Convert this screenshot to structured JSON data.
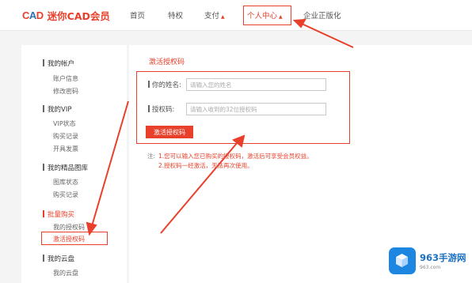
{
  "brand": {
    "logo_mark": "CAD",
    "name": "迷你CAD会员"
  },
  "nav": {
    "home": "首页",
    "privilege": "特权",
    "pay": "支付",
    "personal_center": "个人中心",
    "enterprise": "企业正版化"
  },
  "sidebar": {
    "sections": [
      {
        "title": "我的帐户",
        "items": [
          "账户信息",
          "修改密码"
        ]
      },
      {
        "title": "我的VIP",
        "items": [
          "VIP状态",
          "购买记录",
          "开具发票"
        ]
      },
      {
        "title": "我的精品图库",
        "items": [
          "图库状态",
          "购买记录"
        ]
      },
      {
        "title": "批量购买",
        "items": [
          "我的授权码",
          "激活授权码"
        ],
        "active_item": "激活授权码"
      },
      {
        "title": "我的云盘",
        "items": [
          "我的云盘"
        ]
      }
    ]
  },
  "main": {
    "title": "激活授权码",
    "name_label": "你的姓名:",
    "name_placeholder": "请输入您的姓名",
    "code_label": "授权码:",
    "code_placeholder": "请输入收到的32位授权码",
    "submit_label": "激活授权码",
    "note_label": "注:",
    "note_line1": "1.您可以输入您已购买的授权码，激活后可享受会员权益。",
    "note_line2": "2.授权码一经激活，无法再次使用。"
  },
  "watermark": {
    "title": "963手游网",
    "url": "963.com"
  },
  "colors": {
    "accent": "#e8402b",
    "brand_blue": "#2a6fb6",
    "watermark_blue": "#1c86e0"
  }
}
